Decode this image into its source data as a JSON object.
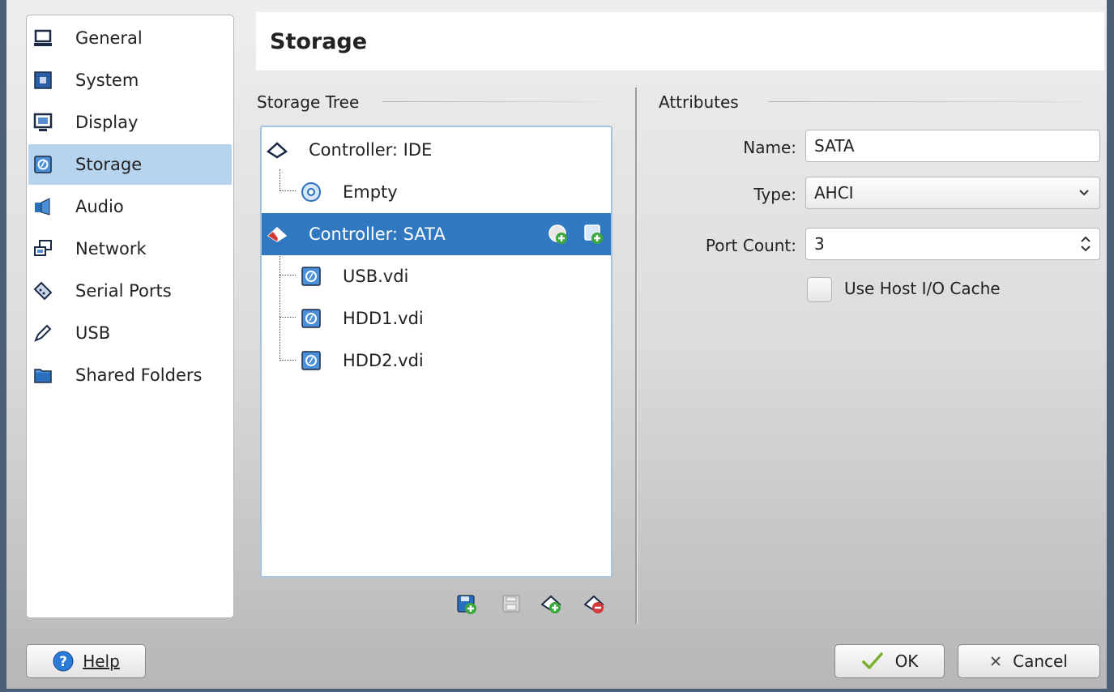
{
  "sidebar": {
    "items": [
      {
        "label": "General",
        "icon": "general-icon"
      },
      {
        "label": "System",
        "icon": "system-icon"
      },
      {
        "label": "Display",
        "icon": "display-icon"
      },
      {
        "label": "Storage",
        "icon": "storage-icon",
        "selected": true
      },
      {
        "label": "Audio",
        "icon": "audio-icon"
      },
      {
        "label": "Network",
        "icon": "network-icon"
      },
      {
        "label": "Serial Ports",
        "icon": "serial-ports-icon"
      },
      {
        "label": "USB",
        "icon": "usb-icon"
      },
      {
        "label": "Shared Folders",
        "icon": "shared-folders-icon"
      }
    ]
  },
  "page": {
    "title": "Storage"
  },
  "storage_tree": {
    "title": "Storage Tree",
    "items": [
      {
        "label": "Controller: IDE",
        "icon": "ide-controller-icon"
      },
      {
        "label": "Empty",
        "icon": "optical-disc-icon"
      },
      {
        "label": "Controller: SATA",
        "icon": "sata-controller-icon",
        "selected": true
      },
      {
        "label": "USB.vdi",
        "icon": "hard-disk-icon"
      },
      {
        "label": "HDD1.vdi",
        "icon": "hard-disk-icon"
      },
      {
        "label": "HDD2.vdi",
        "icon": "hard-disk-icon"
      }
    ]
  },
  "attributes": {
    "title": "Attributes",
    "name_label": "Name:",
    "name_value": "SATA",
    "type_label": "Type:",
    "type_value": "AHCI",
    "port_count_label": "Port Count:",
    "port_count_value": "3",
    "host_cache_label": "Use Host I/O Cache",
    "host_cache_checked": false
  },
  "buttons": {
    "help": "Help",
    "ok": "OK",
    "cancel": "Cancel"
  },
  "colors": {
    "selection": "#3079c1",
    "sidebar_selection": "#b7d4ef",
    "window_border": "#4a5f78"
  }
}
